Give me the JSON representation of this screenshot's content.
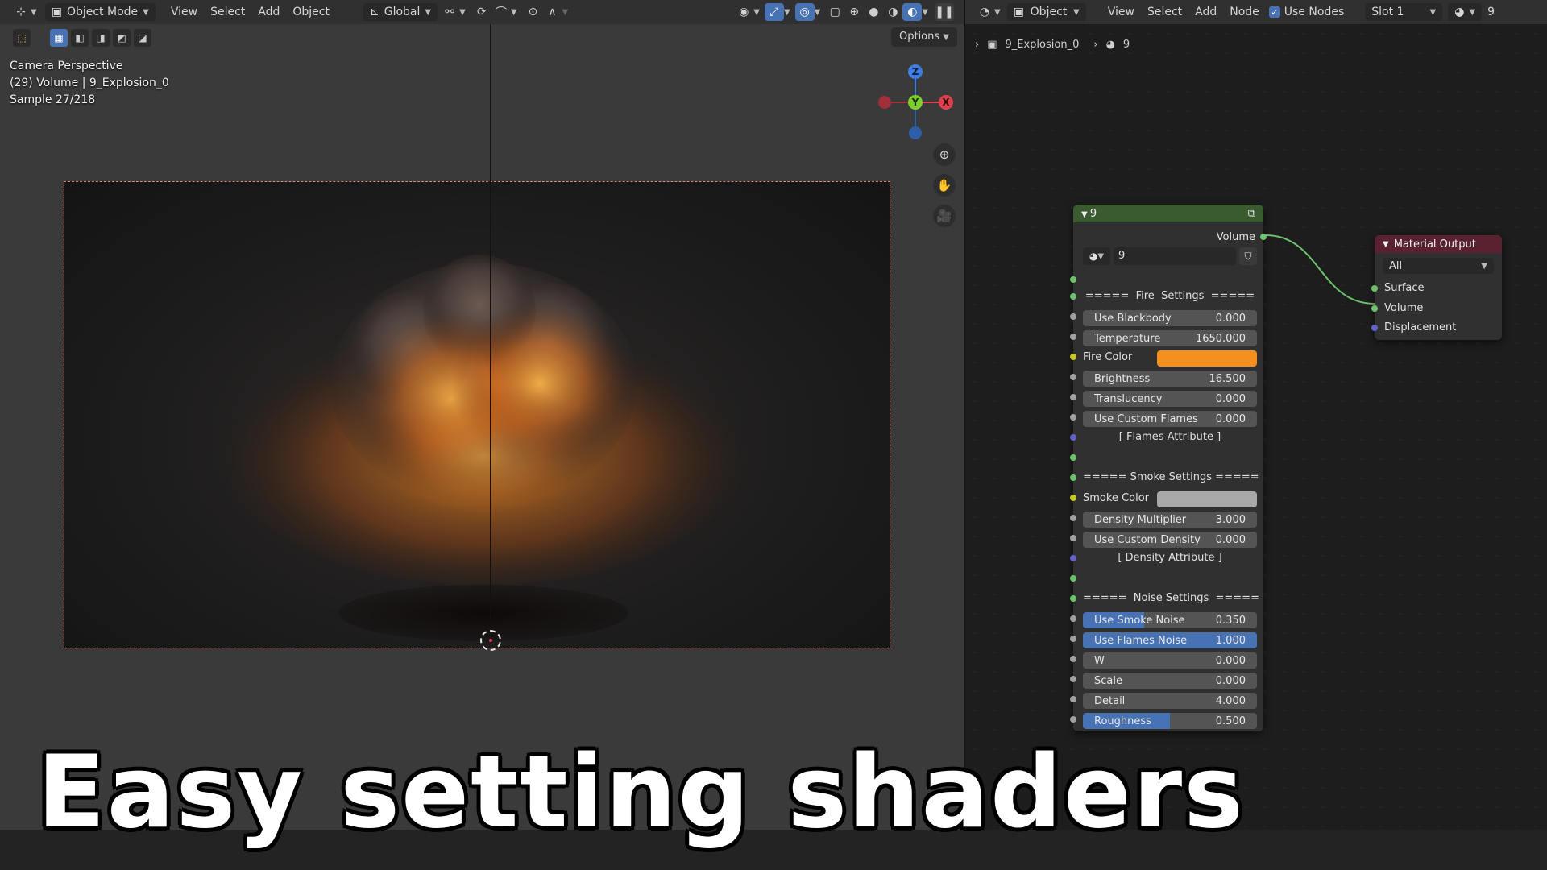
{
  "viewport_header": {
    "mode": "Object Mode",
    "menus": [
      "View",
      "Select",
      "Add",
      "Object"
    ],
    "orientation": "Global",
    "options": "Options"
  },
  "viewport_overlay": {
    "line1": "Camera Perspective",
    "line2": "(29) Volume | 9_Explosion_0",
    "line3": "Sample 27/218"
  },
  "gizmo": {
    "x": "X",
    "y": "Y",
    "z": "Z"
  },
  "node_header": {
    "object": "Object",
    "menus": [
      "View",
      "Select",
      "Add",
      "Node"
    ],
    "use_nodes": "Use Nodes",
    "slot": "Slot 1",
    "material": "9"
  },
  "breadcrumb": {
    "object": "9_Explosion_0",
    "material": "9"
  },
  "group_node": {
    "title": "9",
    "output_label": "Volume",
    "datablock": "9",
    "fire_heading": "=====  Fire  Settings  =====",
    "smoke_heading": "===== Smoke Settings =====",
    "noise_heading": "=====  Noise Settings  =====",
    "fire_fields": [
      {
        "label": "Use Blackbody",
        "value": "0.000",
        "fraction": 0
      },
      {
        "label": "Temperature",
        "value": "1650.000",
        "fraction": 0
      }
    ],
    "fire_color_label": "Fire Color",
    "fire_color": "#f5901e",
    "fire_fields2": [
      {
        "label": "Brightness",
        "value": "16.500",
        "fraction": 0
      },
      {
        "label": "Translucency",
        "value": "0.000",
        "fraction": 0
      },
      {
        "label": "Use Custom Flames",
        "value": "0.000",
        "fraction": 0
      }
    ],
    "flames_attribute": "[ Flames Attribute ]",
    "smoke_color_label": "Smoke Color",
    "smoke_color": "#a8a8a8",
    "smoke_fields": [
      {
        "label": "Density Multiplier",
        "value": "3.000",
        "fraction": 0
      },
      {
        "label": "Use Custom Density",
        "value": "0.000",
        "fraction": 0
      }
    ],
    "density_attribute": "[ Density Attribute ]",
    "noise_fields": [
      {
        "label": "Use Smoke Noise",
        "value": "0.350",
        "fraction": 0.35
      },
      {
        "label": "Use Flames Noise",
        "value": "1.000",
        "fraction": 1.0
      },
      {
        "label": "W",
        "value": "0.000",
        "fraction": 0
      },
      {
        "label": "Scale",
        "value": "0.000",
        "fraction": 0
      },
      {
        "label": "Detail",
        "value": "4.000",
        "fraction": 0
      },
      {
        "label": "Roughness",
        "value": "0.500",
        "fraction": 0.5
      }
    ]
  },
  "output_node": {
    "title": "Material Output",
    "target": "All",
    "inputs": [
      "Surface",
      "Volume",
      "Displacement"
    ]
  },
  "caption": "Easy setting shaders",
  "colors": {
    "accent": "#4772b3",
    "group_header": "#3a5a30",
    "output_header": "#5a2230",
    "link": "#6cc36c"
  }
}
